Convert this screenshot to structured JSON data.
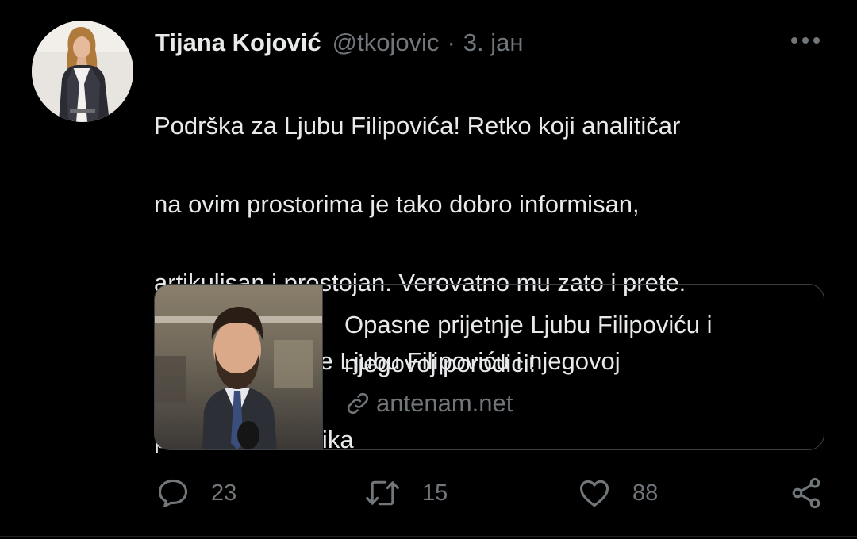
{
  "tweet": {
    "author": {
      "display_name": "Tijana Kojović",
      "handle": "@tkojovic"
    },
    "separator": "·",
    "date": "3. јан",
    "text_lines": [
      "Podrška za Ljubu Filipovića! Retko koji analitičar",
      "na ovim prostorima je tako dobro informisan,",
      "artikulisan i prostojan. Verovatno mu zato i prete.",
      "Opasne prijetnje Ljubu Filipoviću i njegovoj",
      "porodici! :: Politika"
    ]
  },
  "link_card": {
    "title_lines": [
      "Opasne prijetnje Ljubu Filipoviću i",
      "njegovoj porodici!"
    ],
    "domain": "antenam.net"
  },
  "actions": {
    "reply_count": "23",
    "retweet_count": "15",
    "like_count": "88"
  },
  "colors": {
    "background": "#000000",
    "text": "#e7e9ea",
    "secondary": "#71767b",
    "border": "#3d4146"
  },
  "icons": {
    "more": "more-horizontal-icon",
    "link": "link-icon",
    "reply": "reply-bubble-icon",
    "retweet": "retweet-icon",
    "like": "heart-icon",
    "share": "share-icon"
  }
}
